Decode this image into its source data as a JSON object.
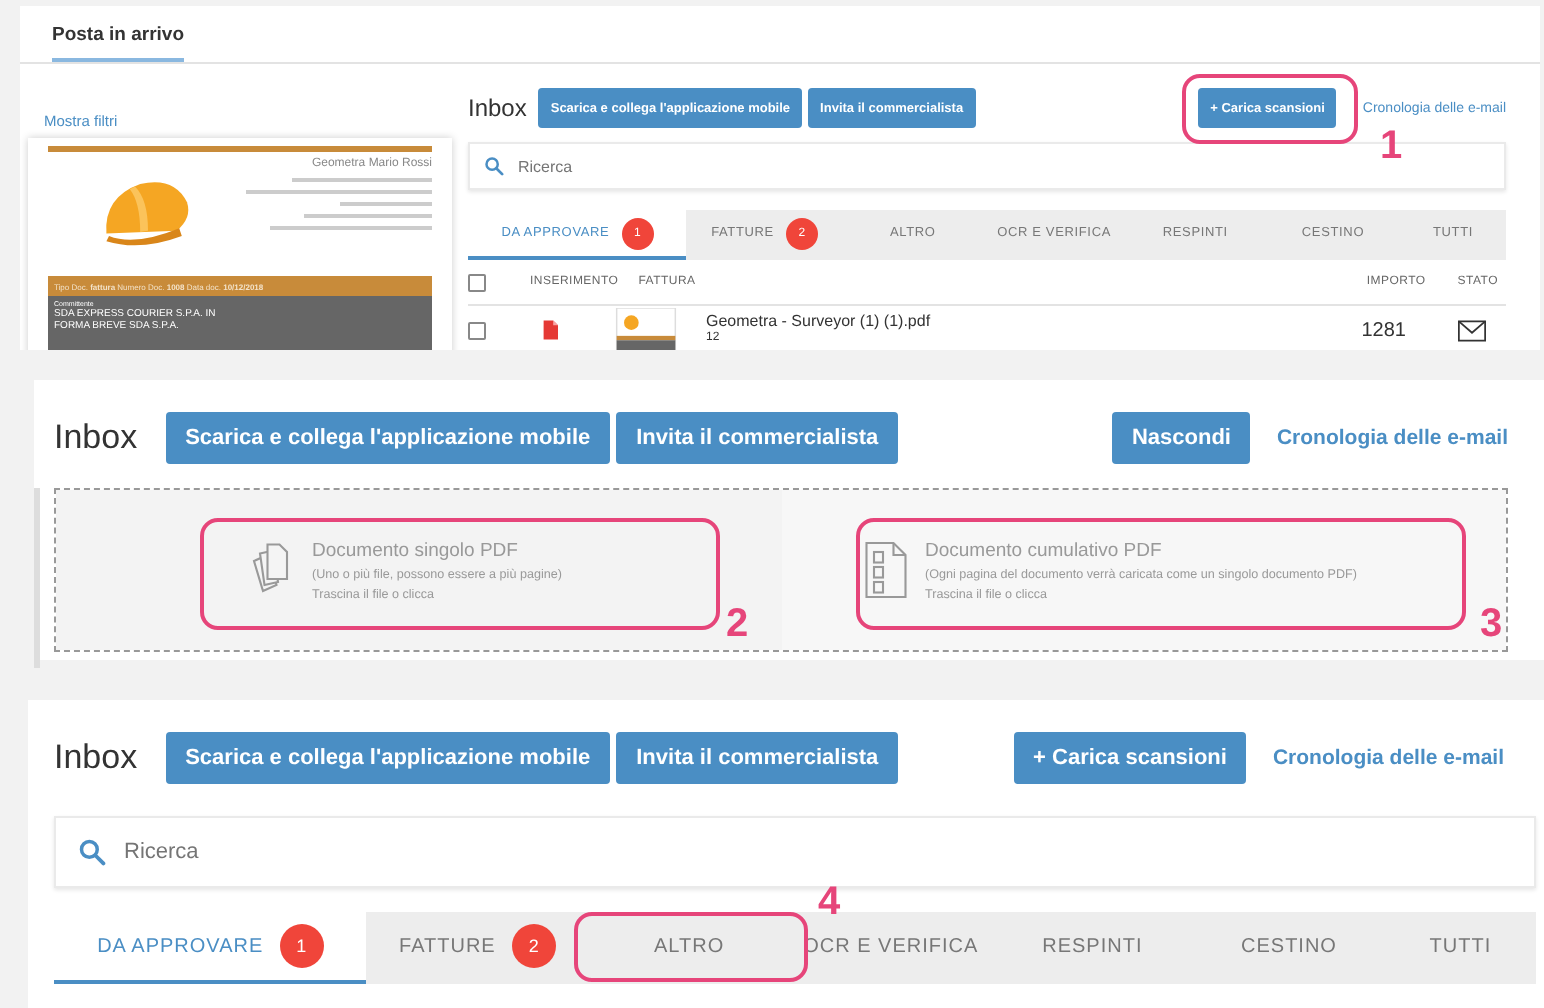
{
  "screen_1": {
    "page_tab": {
      "label": "Posta in arrivo",
      "selected": true
    },
    "filters_link": "Mostra filtri",
    "preview": {
      "sender": "Geometra Mario Rossi",
      "doc_line": "Tipo Doc. **fattura** Numero Doc. **1008** Data doc. **10/12/2018**",
      "client_label": "Committente",
      "client_lines": [
        "SDA EXPRESS COURIER S.P.A. IN",
        "FORMA BREVE SDA S.P.A."
      ]
    },
    "title": "Inbox",
    "buttons": [
      "Scarica e collega l'applicazione mobile",
      "Invita il commercialista"
    ],
    "upload_button": "+ Carica scansioni",
    "history_link": "Cronologia delle e-mail",
    "search": {
      "placeholder": "Ricerca"
    },
    "tabs": [
      {
        "label": "DA APPROVARE",
        "count": "1",
        "selected": true
      },
      {
        "label": "FATTURE",
        "count": "2",
        "selected": false
      },
      {
        "label": "ALTRO",
        "selected": false
      },
      {
        "label": "OCR E VERIFICA",
        "selected": false
      },
      {
        "label": "RESPINTI",
        "selected": false
      },
      {
        "label": "CESTINO",
        "selected": false
      },
      {
        "label": "TUTTI",
        "selected": false
      }
    ],
    "select_all": {
      "checked": false
    },
    "columns": [
      "INSERIMENTO",
      "FATTURA",
      "IMPORTO",
      "STATO"
    ],
    "rows": [
      {
        "checked": false,
        "file": "Geometra - Surveyor (1) (1).pdf",
        "pages": "12",
        "amount": "1281"
      }
    ]
  },
  "screen_2": {
    "title": "Inbox",
    "buttons": [
      "Scarica e collega l'applicazione mobile",
      "Invita il commercialista"
    ],
    "hide_button": "Nascondi",
    "history_link": "Cronologia delle e-mail",
    "dropzones": [
      {
        "kind": "single",
        "title": "Documento singolo PDF",
        "note": "(Uno o più file, possono essere a più pagine)",
        "hint": "Trascina il file o clicca"
      },
      {
        "kind": "multi",
        "title": "Documento cumulativo PDF",
        "note": "(Ogni pagina del documento verrà caricata come un singolo documento PDF)",
        "hint": "Trascina il file o clicca"
      }
    ]
  },
  "screen_3": {
    "title": "Inbox",
    "buttons": [
      "Scarica e collega l'applicazione mobile",
      "Invita il commercialista"
    ],
    "upload_button": "+ Carica scansioni",
    "history_link": "Cronologia delle e-mail",
    "search": {
      "placeholder": "Ricerca"
    },
    "tabs": [
      {
        "label": "DA APPROVARE",
        "count": "1",
        "selected": true
      },
      {
        "label": "FATTURE",
        "count": "2",
        "selected": false
      },
      {
        "label": "ALTRO",
        "selected": false
      },
      {
        "label": "OCR E VERIFICA",
        "selected": false
      },
      {
        "label": "RESPINTI",
        "selected": false
      },
      {
        "label": "CESTINO",
        "selected": false
      },
      {
        "label": "TUTTI",
        "selected": false
      }
    ]
  },
  "callouts": [
    "1",
    "2",
    "3",
    "4"
  ]
}
